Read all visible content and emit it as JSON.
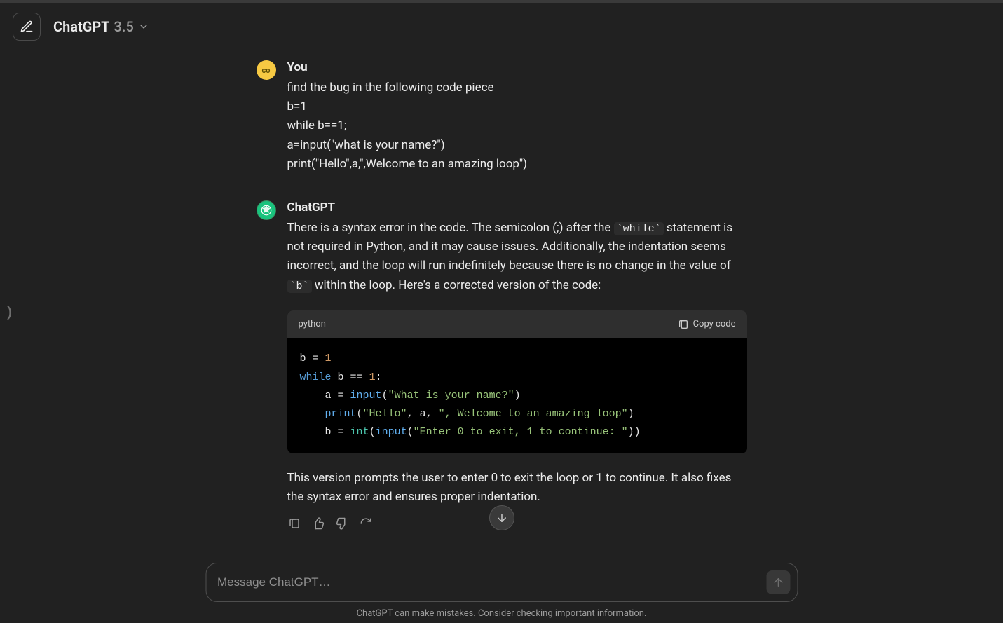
{
  "header": {
    "model_name": "ChatGPT",
    "model_version": "3.5"
  },
  "user_avatar_initials": "co",
  "conversation": {
    "user": {
      "author": "You",
      "lines": [
        "find the bug in the following code piece",
        " b=1",
        " while b==1;",
        "a=input(\"what is your name?\")",
        "print(\"Hello\",a,\",Welcome to an amazing loop\")"
      ]
    },
    "assistant": {
      "author": "ChatGPT",
      "intro_pre": "There is a syntax error in the code. The semicolon (;) after the ",
      "intro_code1": "`while`",
      "intro_mid": " statement is not required in Python, and it may cause issues. Additionally, the indentation seems incorrect, and the loop will run indefinitely because there is no change in the value of ",
      "intro_code2": "`b`",
      "intro_post": " within the loop. Here's a corrected version of the code:",
      "code": {
        "lang": "python",
        "copy_label": "Copy code",
        "tokens": {
          "l1_var": "b",
          "l1_op": " = ",
          "l1_num": "1",
          "l2_kw": "while",
          "l2_sp": " ",
          "l2_var": "b",
          "l2_op": " == ",
          "l2_num": "1",
          "l2_colon": ":",
          "l3_indent": "    ",
          "l3_var": "a",
          "l3_op": " = ",
          "l3_fn": "input",
          "l3_open": "(",
          "l3_str": "\"What is your name?\"",
          "l3_close": ")",
          "l4_indent": "    ",
          "l4_fn": "print",
          "l4_open": "(",
          "l4_str1": "\"Hello\"",
          "l4_c1": ", ",
          "l4_var": "a",
          "l4_c2": ", ",
          "l4_str2": "\", Welcome to an amazing loop\"",
          "l4_close": ")",
          "l5_indent": "    ",
          "l5_var": "b",
          "l5_op": " = ",
          "l5_fn": "int",
          "l5_open": "(",
          "l5_fn2": "input",
          "l5_open2": "(",
          "l5_str": "\"Enter 0 to exit, 1 to continue: \"",
          "l5_close": "))"
        }
      },
      "outro": "This version prompts the user to enter 0 to exit the loop or 1 to continue. It also fixes the syntax error and ensures proper indentation."
    }
  },
  "input": {
    "placeholder": "Message ChatGPT…"
  },
  "disclaimer": "ChatGPT can make mistakes. Consider checking important information."
}
